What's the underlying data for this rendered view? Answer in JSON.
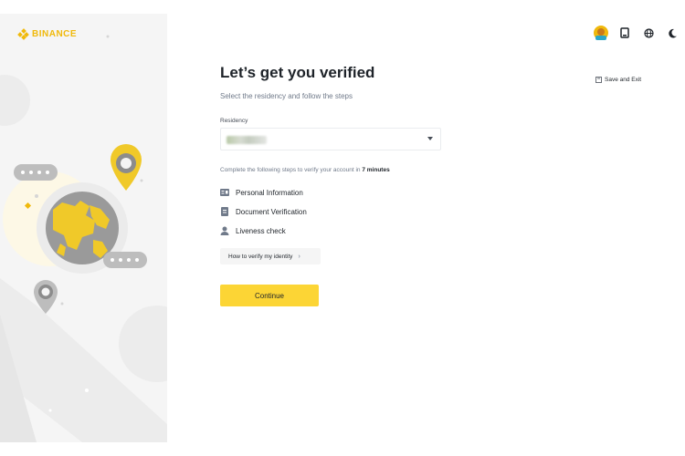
{
  "brand": {
    "name": "BINANCE",
    "accent": "#f0b90b"
  },
  "page": {
    "title": "Let’s get you verified",
    "subtitle": "Select the residency and follow the steps"
  },
  "residency": {
    "label": "Residency",
    "value_redacted": true
  },
  "steps_intro": {
    "prefix": "Complete the following steps to verify your account in ",
    "time": "7 minutes"
  },
  "steps": [
    {
      "label": "Personal Information",
      "icon": "id-card-icon"
    },
    {
      "label": "Document Verification",
      "icon": "document-icon"
    },
    {
      "label": "Liveness check",
      "icon": "person-icon"
    }
  ],
  "how_to": {
    "label": "How to verify my identity",
    "chevron": "›"
  },
  "continue": {
    "label": "Continue",
    "color": "#fcd535"
  },
  "header": {
    "save_exit": "Save and Exit",
    "icons": [
      "avatar",
      "download-app-icon",
      "language-globe-icon",
      "dark-mode-icon"
    ]
  }
}
